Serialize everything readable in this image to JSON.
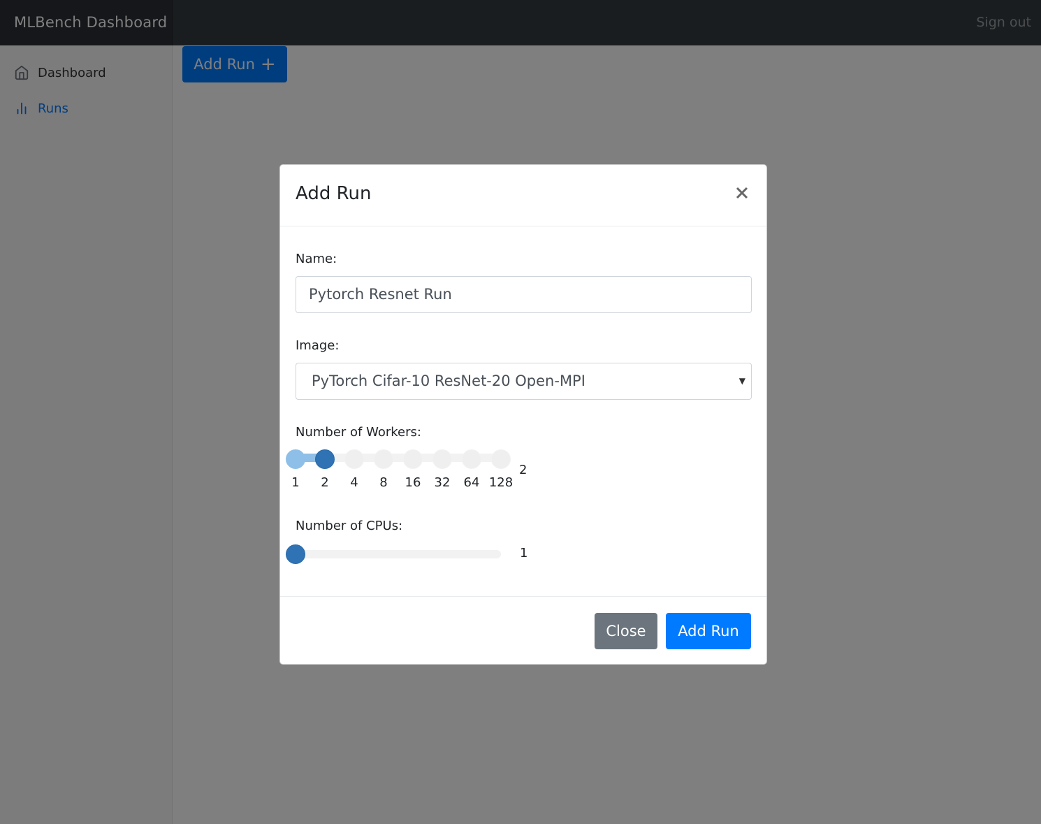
{
  "navbar": {
    "brand": "MLBench Dashboard",
    "signout": "Sign out"
  },
  "sidebar": {
    "items": [
      {
        "label": "Dashboard",
        "icon": "home-icon",
        "active": false
      },
      {
        "label": "Runs",
        "icon": "bar-chart-icon",
        "active": true
      }
    ]
  },
  "main": {
    "add_run_button": "Add Run",
    "add_run_glyph": "+"
  },
  "modal": {
    "title": "Add Run",
    "name_label": "Name:",
    "name_value": "Pytorch Resnet Run",
    "image_label": "Image:",
    "image_value": "PyTorch Cifar-10 ResNet-20 Open-MPI",
    "workers_label": "Number of Workers:",
    "workers_ticks": [
      "1",
      "2",
      "4",
      "8",
      "16",
      "32",
      "64",
      "128"
    ],
    "workers_value": "2",
    "cpus_label": "Number of CPUs:",
    "cpus_value": "1",
    "close_button": "Close",
    "submit_button": "Add Run"
  },
  "colors": {
    "primary": "#007bff",
    "secondary": "#6c757d",
    "navbar": "#343a40",
    "slider_active": "#2f73b5",
    "slider_fill": "#8ebfe8"
  }
}
